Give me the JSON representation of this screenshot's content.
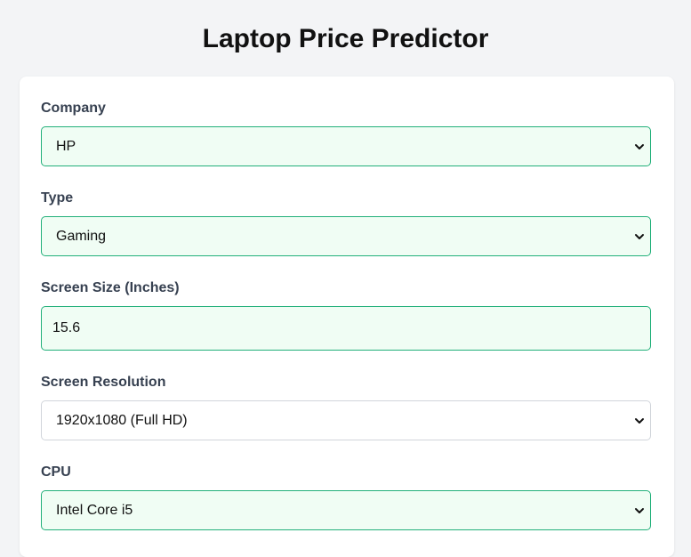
{
  "page": {
    "title": "Laptop Price Predictor"
  },
  "form": {
    "company": {
      "label": "Company",
      "value": "HP"
    },
    "type": {
      "label": "Type",
      "value": "Gaming"
    },
    "screen_size": {
      "label": "Screen Size (Inches)",
      "value": "15.6"
    },
    "screen_resolution": {
      "label": "Screen Resolution",
      "value": "1920x1080 (Full HD)"
    },
    "cpu": {
      "label": "CPU",
      "value": "Intel Core i5"
    }
  },
  "colors": {
    "accent_border": "#22b07a",
    "filled_background": "#f0fdf4",
    "page_background": "#f3f4f6"
  },
  "icons": {
    "dropdown": "chevron-down-icon"
  }
}
